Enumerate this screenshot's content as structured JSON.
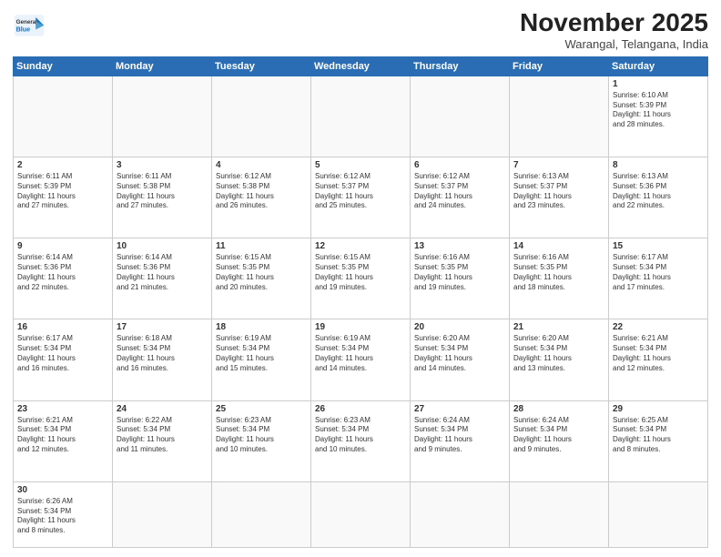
{
  "header": {
    "logo_line1": "General",
    "logo_line2": "Blue",
    "month_title": "November 2025",
    "location": "Warangal, Telangana, India"
  },
  "weekdays": [
    "Sunday",
    "Monday",
    "Tuesday",
    "Wednesday",
    "Thursday",
    "Friday",
    "Saturday"
  ],
  "weeks": [
    [
      {
        "day": "",
        "text": ""
      },
      {
        "day": "",
        "text": ""
      },
      {
        "day": "",
        "text": ""
      },
      {
        "day": "",
        "text": ""
      },
      {
        "day": "",
        "text": ""
      },
      {
        "day": "",
        "text": ""
      },
      {
        "day": "1",
        "text": "Sunrise: 6:10 AM\nSunset: 5:39 PM\nDaylight: 11 hours\nand 28 minutes."
      }
    ],
    [
      {
        "day": "2",
        "text": "Sunrise: 6:11 AM\nSunset: 5:39 PM\nDaylight: 11 hours\nand 27 minutes."
      },
      {
        "day": "3",
        "text": "Sunrise: 6:11 AM\nSunset: 5:38 PM\nDaylight: 11 hours\nand 27 minutes."
      },
      {
        "day": "4",
        "text": "Sunrise: 6:12 AM\nSunset: 5:38 PM\nDaylight: 11 hours\nand 26 minutes."
      },
      {
        "day": "5",
        "text": "Sunrise: 6:12 AM\nSunset: 5:37 PM\nDaylight: 11 hours\nand 25 minutes."
      },
      {
        "day": "6",
        "text": "Sunrise: 6:12 AM\nSunset: 5:37 PM\nDaylight: 11 hours\nand 24 minutes."
      },
      {
        "day": "7",
        "text": "Sunrise: 6:13 AM\nSunset: 5:37 PM\nDaylight: 11 hours\nand 23 minutes."
      },
      {
        "day": "8",
        "text": "Sunrise: 6:13 AM\nSunset: 5:36 PM\nDaylight: 11 hours\nand 22 minutes."
      }
    ],
    [
      {
        "day": "9",
        "text": "Sunrise: 6:14 AM\nSunset: 5:36 PM\nDaylight: 11 hours\nand 22 minutes."
      },
      {
        "day": "10",
        "text": "Sunrise: 6:14 AM\nSunset: 5:36 PM\nDaylight: 11 hours\nand 21 minutes."
      },
      {
        "day": "11",
        "text": "Sunrise: 6:15 AM\nSunset: 5:35 PM\nDaylight: 11 hours\nand 20 minutes."
      },
      {
        "day": "12",
        "text": "Sunrise: 6:15 AM\nSunset: 5:35 PM\nDaylight: 11 hours\nand 19 minutes."
      },
      {
        "day": "13",
        "text": "Sunrise: 6:16 AM\nSunset: 5:35 PM\nDaylight: 11 hours\nand 19 minutes."
      },
      {
        "day": "14",
        "text": "Sunrise: 6:16 AM\nSunset: 5:35 PM\nDaylight: 11 hours\nand 18 minutes."
      },
      {
        "day": "15",
        "text": "Sunrise: 6:17 AM\nSunset: 5:34 PM\nDaylight: 11 hours\nand 17 minutes."
      }
    ],
    [
      {
        "day": "16",
        "text": "Sunrise: 6:17 AM\nSunset: 5:34 PM\nDaylight: 11 hours\nand 16 minutes."
      },
      {
        "day": "17",
        "text": "Sunrise: 6:18 AM\nSunset: 5:34 PM\nDaylight: 11 hours\nand 16 minutes."
      },
      {
        "day": "18",
        "text": "Sunrise: 6:19 AM\nSunset: 5:34 PM\nDaylight: 11 hours\nand 15 minutes."
      },
      {
        "day": "19",
        "text": "Sunrise: 6:19 AM\nSunset: 5:34 PM\nDaylight: 11 hours\nand 14 minutes."
      },
      {
        "day": "20",
        "text": "Sunrise: 6:20 AM\nSunset: 5:34 PM\nDaylight: 11 hours\nand 14 minutes."
      },
      {
        "day": "21",
        "text": "Sunrise: 6:20 AM\nSunset: 5:34 PM\nDaylight: 11 hours\nand 13 minutes."
      },
      {
        "day": "22",
        "text": "Sunrise: 6:21 AM\nSunset: 5:34 PM\nDaylight: 11 hours\nand 12 minutes."
      }
    ],
    [
      {
        "day": "23",
        "text": "Sunrise: 6:21 AM\nSunset: 5:34 PM\nDaylight: 11 hours\nand 12 minutes."
      },
      {
        "day": "24",
        "text": "Sunrise: 6:22 AM\nSunset: 5:34 PM\nDaylight: 11 hours\nand 11 minutes."
      },
      {
        "day": "25",
        "text": "Sunrise: 6:23 AM\nSunset: 5:34 PM\nDaylight: 11 hours\nand 10 minutes."
      },
      {
        "day": "26",
        "text": "Sunrise: 6:23 AM\nSunset: 5:34 PM\nDaylight: 11 hours\nand 10 minutes."
      },
      {
        "day": "27",
        "text": "Sunrise: 6:24 AM\nSunset: 5:34 PM\nDaylight: 11 hours\nand 9 minutes."
      },
      {
        "day": "28",
        "text": "Sunrise: 6:24 AM\nSunset: 5:34 PM\nDaylight: 11 hours\nand 9 minutes."
      },
      {
        "day": "29",
        "text": "Sunrise: 6:25 AM\nSunset: 5:34 PM\nDaylight: 11 hours\nand 8 minutes."
      }
    ],
    [
      {
        "day": "30",
        "text": "Sunrise: 6:26 AM\nSunset: 5:34 PM\nDaylight: 11 hours\nand 8 minutes."
      },
      {
        "day": "",
        "text": ""
      },
      {
        "day": "",
        "text": ""
      },
      {
        "day": "",
        "text": ""
      },
      {
        "day": "",
        "text": ""
      },
      {
        "day": "",
        "text": ""
      },
      {
        "day": "",
        "text": ""
      }
    ]
  ]
}
